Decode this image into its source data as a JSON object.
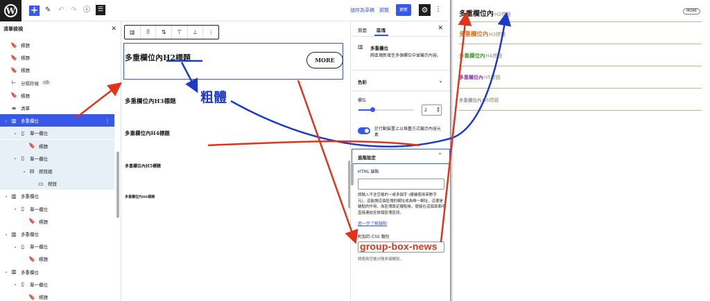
{
  "toolbar": {
    "wp_logo": "W",
    "add_icon": "+",
    "edit_icon": "✎",
    "undo_icon": "↶",
    "redo_icon": "↷",
    "info_icon": "ⓘ",
    "list_view_icon": "☰",
    "save_draft": "儲存為草稿",
    "preview": "預覽",
    "update": "更新",
    "settings_icon": "⚙",
    "options_icon": "⋮"
  },
  "list_view": {
    "title": "清單檢視",
    "close": "✕",
    "items": [
      {
        "label": "標題",
        "icon": "🔖",
        "chev": ""
      },
      {
        "label": "標題",
        "icon": "🔖",
        "chev": ""
      },
      {
        "label": "標題",
        "icon": "🔖",
        "chev": ""
      },
      {
        "label": "分隔符號",
        "icon": "⊢",
        "chev": "",
        "badge": "c0"
      },
      {
        "label": "標題",
        "icon": "🔖",
        "chev": ""
      },
      {
        "label": "清單",
        "icon": "≡",
        "chev": ""
      },
      {
        "label": "多重欄位",
        "icon": "▥",
        "chev": "⌄",
        "more": "⋮"
      },
      {
        "label": "單一欄位",
        "icon": "▯",
        "chev": "⌄"
      },
      {
        "label": "標題",
        "icon": "🔖",
        "chev": ""
      },
      {
        "label": "單一欄位",
        "icon": "▯",
        "chev": "⌄"
      },
      {
        "label": "按鈕組",
        "icon": "⊟",
        "chev": "⌄"
      },
      {
        "label": "按鈕",
        "icon": "▭",
        "chev": ""
      },
      {
        "label": "多重欄位",
        "icon": "▥",
        "chev": "⌄"
      },
      {
        "label": "單一欄位",
        "icon": "▯",
        "chev": "⌄"
      },
      {
        "label": "標題",
        "icon": "🔖",
        "chev": ""
      },
      {
        "label": "多重欄位",
        "icon": "▥",
        "chev": "⌄"
      },
      {
        "label": "單一欄位",
        "icon": "▯",
        "chev": "⌄"
      },
      {
        "label": "標題",
        "icon": "🔖",
        "chev": ""
      },
      {
        "label": "多重欄位",
        "icon": "▥",
        "chev": "⌄"
      },
      {
        "label": "單一欄位",
        "icon": "▯",
        "chev": "⌄"
      },
      {
        "label": "標題",
        "icon": "🔖",
        "chev": ""
      }
    ]
  },
  "block_toolbar": {
    "columns_icon": "▥",
    "drag_icon": "⠿",
    "move_icon": "⇅",
    "align_icon": "⊤",
    "vertical_align_icon": "⊥",
    "more_icon": "⋮"
  },
  "canvas": {
    "h2_prefix": "多重欄位內",
    "h2_bold": "H2標題",
    "more_button": "MORE",
    "h3": "多重欄位內H3標題",
    "h4": "多重欄位內H4標題",
    "h5": "多重欄位內H5標題",
    "h6": "多重欄位內H6標題"
  },
  "sidebar": {
    "tab_page": "頁面",
    "tab_block": "區塊",
    "close": "✕",
    "block_icon": "▥",
    "block_name": "多重欄位",
    "block_desc": "將區塊新增至多個欄位中並顯示內容。",
    "color_section": "色彩",
    "columns_label": "欄位",
    "columns_value": "2",
    "columns_count": 2,
    "columns_slider_fraction": 0.25,
    "stack_label": "於行動裝置上以堆疊方式顯示內容元素",
    "advanced_section": "進階設定",
    "html_anchor_label": "HTML 錨點",
    "html_anchor_value": "",
    "help_text": "請輸入不含空格的一或多個字 (建議使用英數字元)，這能讓這個區塊的網址成為唯一網址，這便是錨點的作用，為區塊設定錨點後，便能在這個頁面中直接連結至該個區塊區段。",
    "learn_more": "進一步了解錨點",
    "css_label": "附加的 CSS 類別",
    "css_value": "group-box-news",
    "css_help": "請使用空格分隔多個類別。",
    "chevron_down": "⌄",
    "chevron_up": "⌃"
  },
  "preview": {
    "rows": [
      {
        "main": "多重欄位內",
        "sub": "H2標題",
        "color": "#1e1e1e",
        "more": "MORE"
      },
      {
        "main": "多重欄位內",
        "sub": "H3標題",
        "color": "#d4782a"
      },
      {
        "main": "多重欄位內",
        "sub": "H4標題",
        "color": "#4f9a36"
      },
      {
        "main": "多重欄位內",
        "sub": "H5標題",
        "color": "#8a3fa3"
      },
      {
        "main": "多重欄位內",
        "sub": "H6標題",
        "color": "#9c9c9c"
      }
    ]
  },
  "annotations": {
    "bold_label": "粗體",
    "arrow_red": "#e2321a",
    "arrow_blue": "#1d39c8"
  }
}
